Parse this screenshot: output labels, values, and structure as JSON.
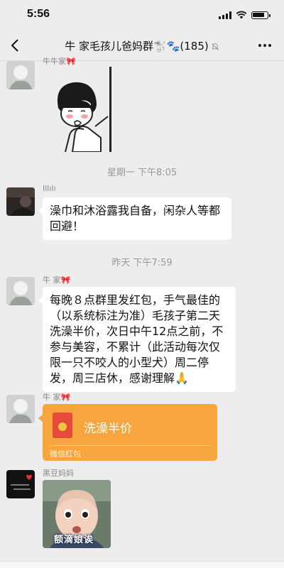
{
  "status_bar": {
    "time": "5:56"
  },
  "nav": {
    "title": "牛 家毛孩儿爸妈群🐩🐾(185)",
    "back_icon": "chevron-left-icon",
    "mute_icon": "bell-off-icon",
    "more_icon": "ellipsis-icon"
  },
  "messages": {
    "m1": {
      "sender": "牛牛家🎀",
      "type": "sticker"
    },
    "ts1": "星期一 下午8:05",
    "m2": {
      "sender": "Illılı",
      "text": "澡巾和沐浴露我自备，闲杂人等都回避！"
    },
    "ts2": "昨天 下午7:59",
    "m3": {
      "sender": "牛 家🎀",
      "text": "每晚８点群里发红包，手气最佳的（以系统标注为准）毛孩子第二天洗澡半价，次日中午12点之前，不参与美容，不累计（此活动每次仅限一只不咬人的小型犬）周二停发，周三店休，感谢理解🙏"
    },
    "m4": {
      "sender": "牛 家🎀",
      "red_packet_title": "洗澡半价",
      "red_packet_label": "微信红包"
    },
    "m5": {
      "sender": "黑豆妈妈",
      "photo_caption": "额滴娘诶"
    }
  },
  "colors": {
    "background": "#ededed",
    "bubble": "#ffffff",
    "red_packet": "#f6a53f"
  }
}
